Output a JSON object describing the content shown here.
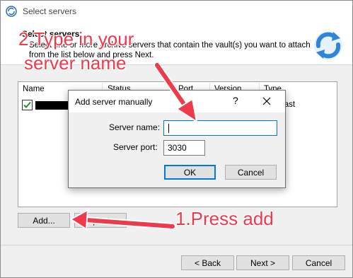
{
  "window": {
    "title": "Select servers"
  },
  "header": {
    "title": "Select servers",
    "description": "Select one or more archive servers that contain the vault(s) you want to attach from the list below and press Next."
  },
  "server_list": {
    "columns": [
      "Name",
      "Status",
      "Port",
      "Version",
      "Type"
    ],
    "rows": [
      {
        "checked": true,
        "name": "",
        "type": "cast"
      }
    ]
  },
  "buttons": {
    "add": "Add...",
    "update": "Update",
    "back": "< Back",
    "next": "Next >",
    "cancel": "Cancel"
  },
  "dialog": {
    "title": "Add server manually",
    "help": "?",
    "server_name_label": "Server name:",
    "server_name_value": "",
    "server_port_label": "Server port:",
    "server_port_value": "3030",
    "ok": "OK",
    "cancel": "Cancel"
  },
  "annotations": {
    "step2_line1": "2.Type in your",
    "step2_line2": "server name",
    "step1": "1.Press add",
    "arrow_color": "#ee3a4a"
  }
}
